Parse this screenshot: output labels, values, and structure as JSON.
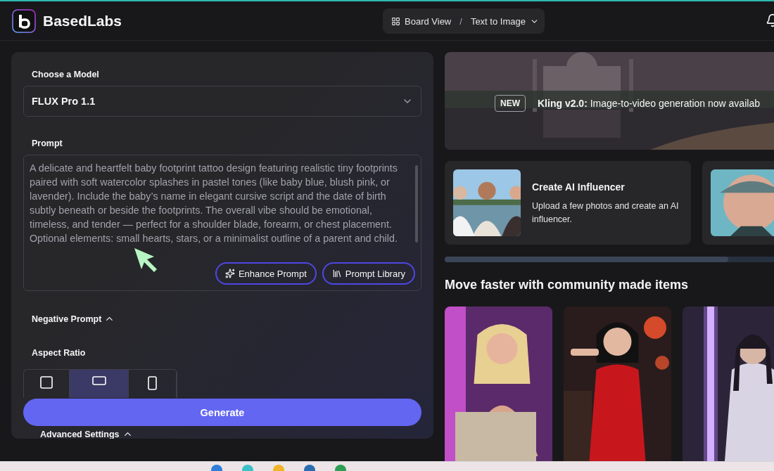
{
  "header": {
    "brand": "BasedLabs",
    "breadcrumb": {
      "view": "Board View",
      "separator": "/",
      "current": "Text to Image"
    }
  },
  "generator": {
    "model_label": "Choose a Model",
    "model": "FLUX Pro 1.1",
    "prompt_label": "Prompt",
    "prompt": "A delicate and heartfelt baby footprint tattoo design featuring realistic tiny footprints paired with soft watercolor splashes in pastel tones (like baby blue, blush pink, or lavender). Include the baby’s name in elegant cursive script and the date of birth subtly beneath or beside the footprints. The overall vibe should be emotional, timeless, and tender — perfect for a shoulder blade, forearm, or chest placement. Optional elements: small hearts, stars, or a minimalist outline of a parent and child.",
    "prompt_buttons": [
      {
        "kind": "enhance",
        "label": "Enhance Prompt"
      },
      {
        "kind": "library",
        "label": "Prompt Library"
      }
    ],
    "negative_prompt": "Negative Prompt",
    "aspect_label": "Aspect Ratio",
    "aspect_options": [
      {
        "kind": "square",
        "selected": false
      },
      {
        "kind": "landscape",
        "selected": true
      },
      {
        "kind": "portrait",
        "selected": false
      }
    ],
    "generate": "Generate",
    "advanced": "Advanced Settings"
  },
  "banner": {
    "badge": "NEW",
    "text": "**Kling v2.0:** Image-to-video generation now availab"
  },
  "feature_cards": [
    {
      "kind": "feature",
      "title": "Create AI Influencer",
      "description": "Upload a few photos and create an AI influencer."
    },
    {
      "kind": "picture"
    }
  ],
  "community": {
    "title": "Move faster with community made items",
    "items": [
      {
        "kind": "picture"
      },
      {
        "kind": "picture"
      },
      {
        "kind": "picture"
      }
    ]
  }
}
